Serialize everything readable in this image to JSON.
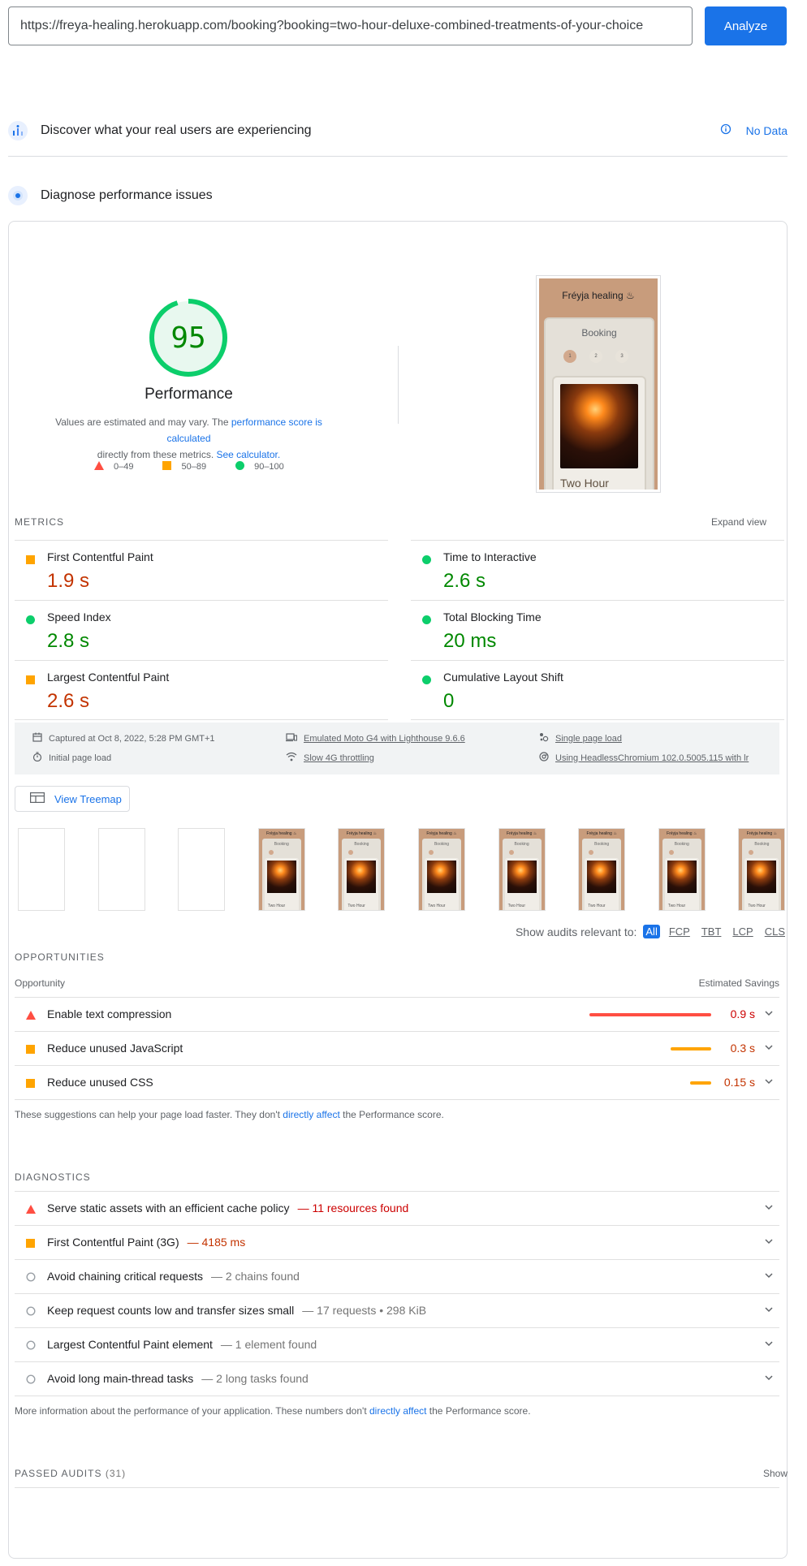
{
  "search": {
    "url_value": "https://freya-healing.herokuapp.com/booking?booking=two-hour-deluxe-combined-treatments-of-your-choice",
    "analyze_label": "Analyze"
  },
  "field_data": {
    "title": "Discover what your real users are experiencing",
    "no_data_label": "No Data"
  },
  "lab": {
    "title": "Diagnose performance issues",
    "score": "95",
    "score_value": 95,
    "category": "Performance",
    "desc_prefix": "Values are estimated and may vary. The ",
    "desc_link1": "performance score is calculated",
    "desc_middle": " directly from these metrics. ",
    "desc_link2": "See calculator.",
    "legend": [
      "0–49",
      "50–89",
      "90–100"
    ]
  },
  "screenshot": {
    "logo": "Fréyja healing ♨",
    "booking": "Booking",
    "steps": [
      "1",
      "2",
      "3"
    ],
    "caption": "Two Hour"
  },
  "metrics": {
    "label": "METRICS",
    "expand_label": "Expand view",
    "items": [
      {
        "name": "First Contentful Paint",
        "value": "1.9 s",
        "rating": "average"
      },
      {
        "name": "Time to Interactive",
        "value": "2.6 s",
        "rating": "pass"
      },
      {
        "name": "Speed Index",
        "value": "2.8 s",
        "rating": "pass"
      },
      {
        "name": "Total Blocking Time",
        "value": "20 ms",
        "rating": "pass"
      },
      {
        "name": "Largest Contentful Paint",
        "value": "2.6 s",
        "rating": "average"
      },
      {
        "name": "Cumulative Layout Shift",
        "value": "0",
        "rating": "pass"
      }
    ]
  },
  "runtime": {
    "captured": "Captured at Oct 8, 2022, 5:28 PM GMT+1",
    "device": "Emulated Moto G4 with Lighthouse 9.6.6",
    "load": "Single page load",
    "initial": "Initial page load",
    "throttling": "Slow 4G throttling",
    "browser": "Using HeadlessChromium 102.0.5005.115 with lr"
  },
  "treemap_label": "View Treemap",
  "filmstrip": {
    "frame_logo": "Fréyja healing ♨",
    "frame_booking": "Booking",
    "frame_caption": "Two Hour"
  },
  "filter": {
    "label": "Show audits relevant to:",
    "chips": [
      "All",
      "FCP",
      "TBT",
      "LCP",
      "CLS"
    ]
  },
  "opportunities": {
    "title": "OPPORTUNITIES",
    "col_left": "Opportunity",
    "col_right": "Estimated Savings",
    "items": [
      {
        "title": "Enable text compression",
        "savings": "0.9 s",
        "rating": "fail",
        "fraction": 1.0
      },
      {
        "title": "Reduce unused JavaScript",
        "savings": "0.3 s",
        "rating": "average",
        "fraction": 0.33
      },
      {
        "title": "Reduce unused CSS",
        "savings": "0.15 s",
        "rating": "average",
        "fraction": 0.17
      }
    ],
    "note_prefix": "These suggestions can help your page load faster. They don't ",
    "note_link": "directly affect",
    "note_suffix": " the Performance score."
  },
  "diagnostics": {
    "title": "DIAGNOSTICS",
    "items": [
      {
        "title": "Serve static assets with an efficient cache policy",
        "display": "— 11 resources found",
        "rating": "fail"
      },
      {
        "title": "First Contentful Paint (3G)",
        "display": "— 4185 ms",
        "rating": "average"
      },
      {
        "title": "Avoid chaining critical requests",
        "display": "— 2 chains found",
        "rating": "info"
      },
      {
        "title": "Keep request counts low and transfer sizes small",
        "display": "— 17 requests • 298 KiB",
        "rating": "info"
      },
      {
        "title": "Largest Contentful Paint element",
        "display": "— 1 element found",
        "rating": "info"
      },
      {
        "title": "Avoid long main-thread tasks",
        "display": "— 2 long tasks found",
        "rating": "info"
      }
    ],
    "note_prefix": "More information about the performance of your application. These numbers don't ",
    "note_link": "directly affect",
    "note_suffix": " the Performance score."
  },
  "passed": {
    "title": "PASSED AUDITS",
    "count": "(31)",
    "show_label": "Show"
  },
  "colors": {
    "pass": "#0cce6b",
    "average": "#ffa400",
    "fail": "#ff4e42",
    "accent": "#1a73e8"
  }
}
